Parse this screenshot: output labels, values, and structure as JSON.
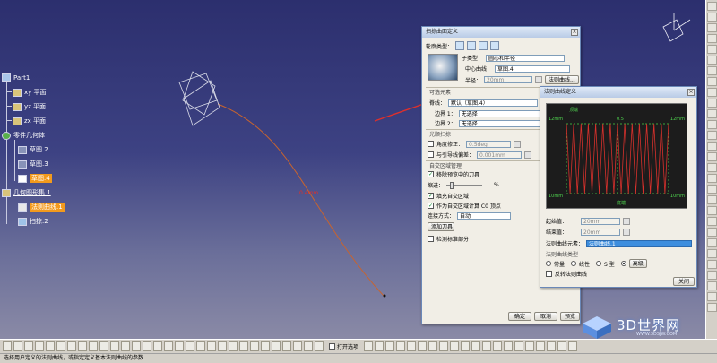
{
  "tree": {
    "root": "Part1",
    "planes": [
      "xy 平面",
      "yz 平面",
      "zx 平面"
    ],
    "body": "零件几何体",
    "sketches": [
      "草图.2",
      "草图.3",
      "草图.4"
    ],
    "geo_set": "几何图形集.1",
    "law_curve": "法则曲线.1",
    "sweep": "扫掠.2"
  },
  "sweep_dialog": {
    "title": "扫掠曲面定义",
    "profile_type_label": "轮廓类型：",
    "subtype_label": "子类型：",
    "subtype_value": "圆心和半径",
    "center_curve_label": "中心曲线：",
    "center_curve_value": "草图.4",
    "radius_label": "半径：",
    "radius_value": "20mm",
    "law_curve_button": "法则曲线...",
    "optional_elements_label": "可选元素",
    "spine_label": "脊线：",
    "spine_value": "默认（草图.4）",
    "boundary1_label": "边界 1：",
    "boundary1_value": "无选择",
    "boundary2_label": "边界 2：",
    "boundary2_value": "无选择",
    "smooth_label": "光顺扫掠",
    "angle_correction_label": "角度修正：",
    "angle_correction_value": "0.5deg",
    "deviation_label": "与引导线偏差：",
    "deviation_value": "0.001mm",
    "self_intersection_label": "自交区域管理",
    "remove_cutter_label": "移除预览中的刀具",
    "tolerance_label": "缩进：",
    "tolerance_unit": "%",
    "fill_twisted_label": "填充自交区域",
    "compute_c0_label": "作为自交区域计算 C0 顶点",
    "connect_mode_label": "连接方式：",
    "connect_mode_value": "自动",
    "add_cutter_button": "添加刀具",
    "canonical_label": "检测标准部分",
    "ok_button": "确定",
    "cancel_button": "取消",
    "preview_button": "预览"
  },
  "law_dialog": {
    "title": "法则曲线定义",
    "plot_top_left": "12mm",
    "plot_top_right": "12mm",
    "plot_bottom_left": "10mm",
    "plot_bottom_right": "10mm",
    "plot_center_label": "0.5",
    "plot_top_center": "顶端",
    "plot_bottom_center": "底端",
    "start_value_label": "起始值：",
    "start_value": "20mm",
    "end_value_label": "结束值：",
    "end_value": "20mm",
    "law_element_label": "法则曲线元素：",
    "law_element_value": "法则曲线.1",
    "law_type_label": "法则曲线类型",
    "type_constant": "常量",
    "type_linear": "线性",
    "type_s": "S 型",
    "type_advanced": "高级",
    "invert_label": "反转法则曲线",
    "close_button": "关闭"
  },
  "viewport": {
    "annotation": "0.4mm"
  },
  "bottom_toolbar": {
    "open_label": "打开选项"
  },
  "status": {
    "text": "选择用户定义的法则曲线，或指定定义基本法则曲线的参数"
  },
  "watermark": {
    "brand": "3D世界网",
    "url": "WWW.3DSJW.COM"
  },
  "chart_data": {
    "type": "line",
    "title": "",
    "x_range": [
      0,
      1
    ],
    "y_range": [
      10,
      12
    ],
    "description_series": [
      {
        "values": [
          12,
          10,
          12,
          10,
          12,
          10,
          12,
          10,
          12,
          10,
          12,
          10,
          12,
          10,
          12,
          10,
          12,
          10,
          12,
          10,
          12,
          10,
          12,
          10,
          12,
          10,
          12,
          10,
          12
        ]
      }
    ]
  },
  "colors": {
    "arrow": "#e0302a",
    "highlight": "#f29a1d",
    "curve": "#c8642e"
  }
}
